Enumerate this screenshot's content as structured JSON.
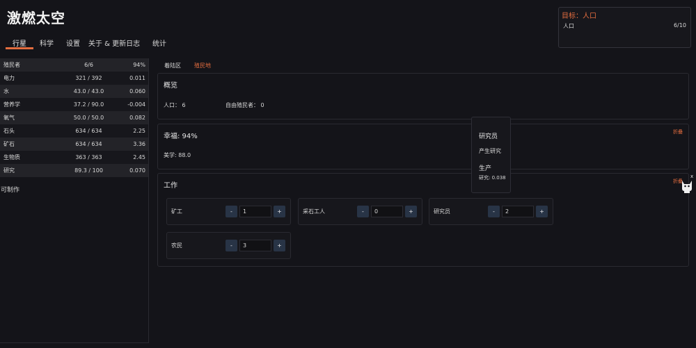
{
  "app": {
    "title": "激燃太空"
  },
  "tabs": [
    {
      "label": "行星"
    },
    {
      "label": "科学"
    },
    {
      "label": "设置"
    },
    {
      "label": "关于 & 更新日志"
    },
    {
      "label": "统计"
    }
  ],
  "goal": {
    "title": "目标：人口",
    "label": "人口",
    "value": "6/10"
  },
  "resources": [
    {
      "name": "殖民者",
      "amount": "6/6",
      "rate": "94%"
    },
    {
      "name": "电力",
      "amount": "321 / 392",
      "rate": "0.011"
    },
    {
      "name": "水",
      "amount": "43.0 / 43.0",
      "rate": "0.060"
    },
    {
      "name": "营养学",
      "amount": "37.2 / 90.0",
      "rate": "-0.004"
    },
    {
      "name": "氧气",
      "amount": "50.0 / 50.0",
      "rate": "0.082"
    },
    {
      "name": "石头",
      "amount": "634 / 634",
      "rate": "2.25"
    },
    {
      "name": "矿石",
      "amount": "634 / 634",
      "rate": "3.36"
    },
    {
      "name": "生物质",
      "amount": "363 / 363",
      "rate": "2.45"
    },
    {
      "name": "研究",
      "amount": "89.3 / 100",
      "rate": "0.070"
    }
  ],
  "sidebar": {
    "craft_label": "可制作"
  },
  "subtabs": [
    {
      "label": "着陆区"
    },
    {
      "label": "殖民地"
    }
  ],
  "overview": {
    "title": "概览",
    "population_label": "人口：",
    "population_value": "6",
    "free_label": "自由殖民者：",
    "free_value": "0"
  },
  "happiness": {
    "title": "幸福: 94%",
    "collapse": "折叠",
    "aesthetic": "美学: 88.0"
  },
  "jobs": {
    "title": "工作",
    "collapse": "折叠",
    "items": [
      {
        "name": "矿工",
        "value": "1",
        "minus": "-",
        "plus": "+"
      },
      {
        "name": "采石工人",
        "value": "0",
        "minus": "-",
        "plus": "+"
      },
      {
        "name": "研究员",
        "value": "2",
        "minus": "-",
        "plus": "+"
      },
      {
        "name": "农民",
        "value": "3",
        "minus": "-",
        "plus": "+"
      }
    ]
  },
  "tooltip": {
    "title": "研究员",
    "description": "产生研究",
    "section": "生产",
    "value": "研究: 0.038"
  },
  "mascot": {
    "close": "x",
    "icon": "cat-icon"
  },
  "colors": {
    "accent": "#e46d3f",
    "button": "#283446",
    "background": "#141419"
  }
}
